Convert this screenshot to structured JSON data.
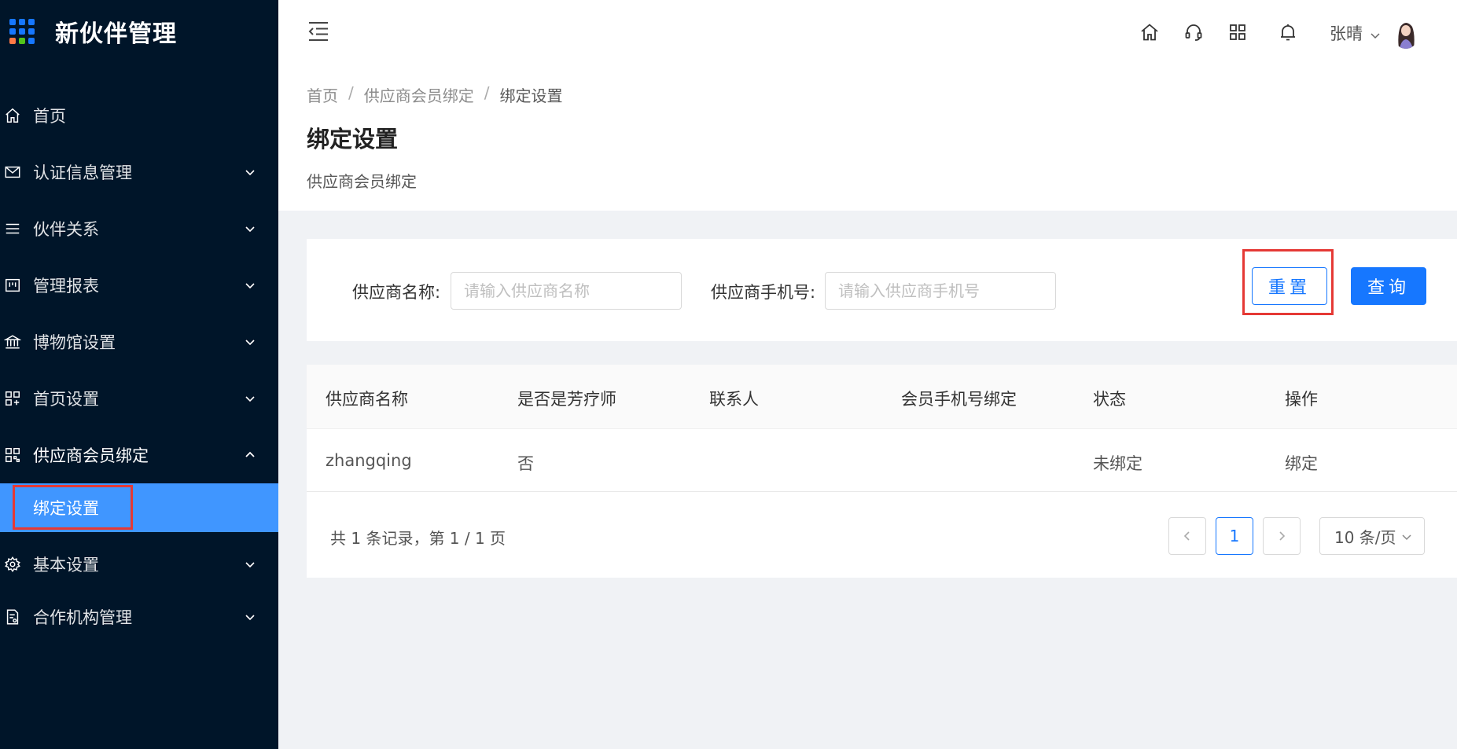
{
  "app": {
    "title": "新伙伴管理"
  },
  "colors": {
    "sidebar_bg": "#001529",
    "accent": "#1677ff",
    "selected_menu": "#4096ff",
    "highlight_box": "#e53935"
  },
  "sidebar": {
    "items": [
      {
        "label": "首页",
        "icon": "home-icon",
        "has_children": false
      },
      {
        "label": "认证信息管理",
        "icon": "mail-icon",
        "has_children": true
      },
      {
        "label": "伙伴关系",
        "icon": "list-icon",
        "has_children": true
      },
      {
        "label": "管理报表",
        "icon": "report-icon",
        "has_children": true
      },
      {
        "label": "博物馆设置",
        "icon": "bank-icon",
        "has_children": true
      },
      {
        "label": "首页设置",
        "icon": "appstore-icon",
        "has_children": true
      },
      {
        "label": "供应商会员绑定",
        "icon": "qrcode-icon",
        "has_children": true,
        "open": true
      },
      {
        "label": "基本设置",
        "icon": "gear-icon",
        "has_children": true
      },
      {
        "label": "合作机构管理",
        "icon": "file-icon",
        "has_children": true
      }
    ],
    "subitem": {
      "label": "绑定设置",
      "selected": true
    }
  },
  "header": {
    "icons": [
      "home-icon",
      "headset-icon",
      "apps-icon",
      "bell-icon"
    ],
    "user_name": "张晴"
  },
  "breadcrumb": [
    "首页",
    "供应商会员绑定",
    "绑定设置"
  ],
  "page": {
    "title": "绑定设置",
    "description": "供应商会员绑定"
  },
  "search": {
    "name_label": "供应商名称:",
    "name_placeholder": "请输入供应商名称",
    "phone_label": "供应商手机号:",
    "phone_placeholder": "请输入供应商手机号",
    "reset_label": "重置",
    "query_label": "查询"
  },
  "table": {
    "columns": [
      "供应商名称",
      "是否是芳疗师",
      "联系人",
      "会员手机号绑定",
      "状态",
      "操作"
    ],
    "rows": [
      {
        "name": "zhangqing",
        "is_therapist": "否",
        "contact": "",
        "phone_bound": "",
        "status": "未绑定",
        "action": "绑定"
      }
    ]
  },
  "pagination": {
    "summary": "共 1 条记录，第 1 / 1 页",
    "current_page": "1",
    "page_size": "10 条/页"
  }
}
